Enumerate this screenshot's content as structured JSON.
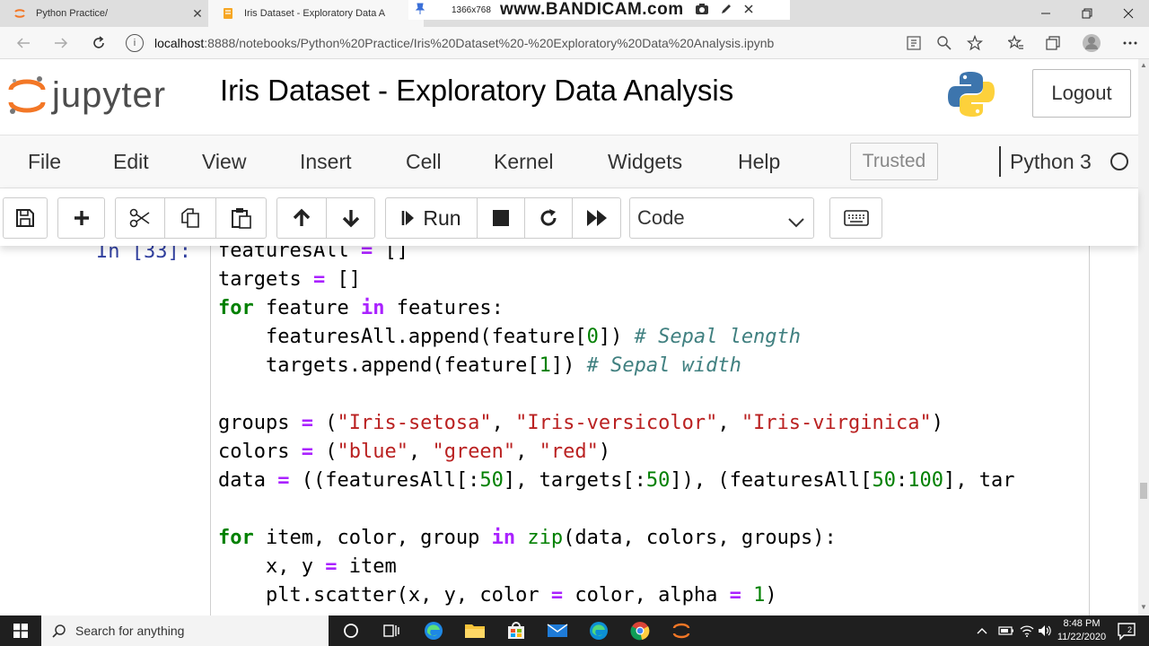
{
  "browser": {
    "tabs": [
      {
        "label": "Python Practice/",
        "close": "✕"
      },
      {
        "label": "Iris Dataset - Exploratory Data A",
        "close": ""
      }
    ],
    "recorder": {
      "resolution": "1366x768",
      "brand": "www.BANDICAM.com"
    },
    "url": {
      "host": "localhost",
      "path": ":8888/notebooks/Python%20Practice/Iris%20Dataset%20-%20Exploratory%20Data%20Analysis.ipynb"
    }
  },
  "jupyter": {
    "logo_text": "jupyter",
    "notebook_title": "Iris Dataset - Exploratory Data Analysis",
    "logout_label": "Logout",
    "menu": [
      "File",
      "Edit",
      "View",
      "Insert",
      "Cell",
      "Kernel",
      "Widgets",
      "Help"
    ],
    "trusted_label": "Trusted",
    "kernel_name": "Python 3",
    "toolbar": {
      "run_label": "Run",
      "cell_type": "Code"
    }
  },
  "cell": {
    "prompt": "In [33]:"
  },
  "taskbar": {
    "search_placeholder": "Search for anything",
    "time": "8:48 PM",
    "date": "11/22/2020",
    "notification_count": "2"
  },
  "colors": {
    "jupyter_orange": "#f37726",
    "prompt_blue": "#303f9f",
    "keyword_green": "#008000",
    "operator_purple": "#aa22ff",
    "string_red": "#ba2121",
    "comment_teal": "#408080"
  }
}
